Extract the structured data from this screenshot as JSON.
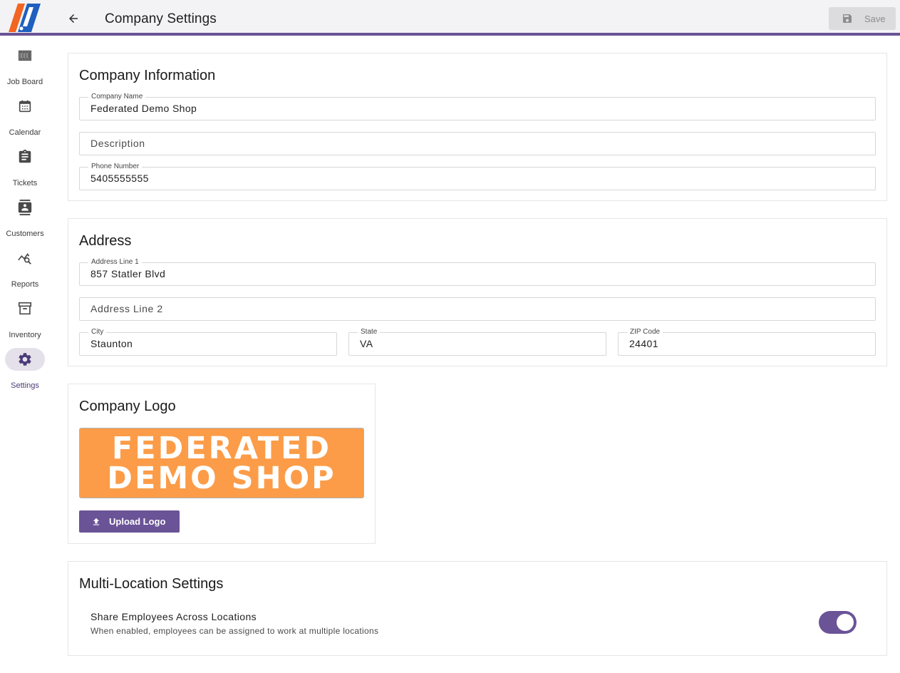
{
  "header": {
    "title": "Company Settings",
    "save_label": "Save"
  },
  "sidebar": {
    "items": [
      {
        "label": "Job Board",
        "icon": "view-column-icon"
      },
      {
        "label": "Calendar",
        "icon": "calendar-icon"
      },
      {
        "label": "Tickets",
        "icon": "clipboard-icon"
      },
      {
        "label": "Customers",
        "icon": "contacts-icon"
      },
      {
        "label": "Reports",
        "icon": "query-stats-icon"
      },
      {
        "label": "Inventory",
        "icon": "archive-icon"
      },
      {
        "label": "Settings",
        "icon": "gear-icon",
        "active": true
      }
    ]
  },
  "company_info": {
    "title": "Company Information",
    "company_name": {
      "label": "Company Name",
      "value": "Federated Demo Shop"
    },
    "description": {
      "placeholder": "Description",
      "value": ""
    },
    "phone": {
      "label": "Phone Number",
      "value": "5405555555"
    }
  },
  "address": {
    "title": "Address",
    "line1": {
      "label": "Address Line 1",
      "value": "857 Statler Blvd"
    },
    "line2": {
      "placeholder": "Address Line 2",
      "value": ""
    },
    "city": {
      "label": "City",
      "value": "Staunton"
    },
    "state": {
      "label": "State",
      "value": "VA"
    },
    "zip": {
      "label": "ZIP Code",
      "value": "24401"
    }
  },
  "logo": {
    "title": "Company Logo",
    "image_text_line1": "FEDERATED",
    "image_text_line2": "DEMO SHOP",
    "upload_label": "Upload Logo"
  },
  "multi_location": {
    "title": "Multi-Location Settings",
    "share_employees": {
      "title": "Share Employees Across Locations",
      "description": "When enabled, employees can be assigned to work at multiple locations",
      "enabled": true
    }
  },
  "colors": {
    "accent": "#6a5396",
    "logo_orange": "#fc9c48",
    "brand_blue": "#1f5fbf",
    "brand_orange": "#f26522"
  }
}
